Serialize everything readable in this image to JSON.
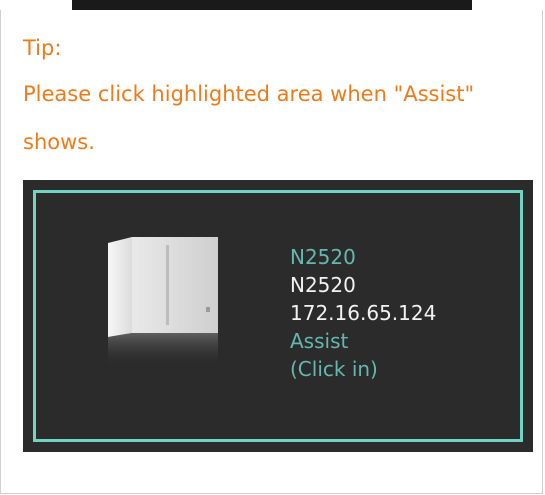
{
  "tip": {
    "title": "Tip:",
    "line1": "Please click highlighted area when \"Assist\"",
    "line2": "shows."
  },
  "device": {
    "model_label": "N2520",
    "name": "N2520",
    "ip": "172.16.65.124",
    "status": "Assist",
    "action": "(Click in)",
    "icon": "nas-device-icon"
  },
  "colors": {
    "tip_text": "#f07a1a",
    "highlight_border": "#6fd4c4",
    "card_bg": "#2b2b2b",
    "accent_text": "#64b8b0"
  }
}
